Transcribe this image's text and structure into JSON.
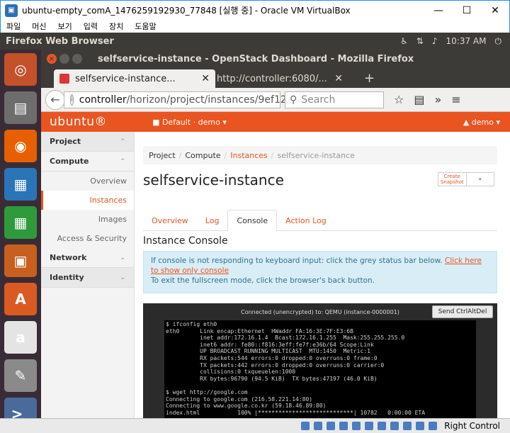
{
  "window": {
    "title": "ubuntu-empty_comA_1476259192930_77848 [실행 중] - Oracle VM VirtualBox",
    "min": "—",
    "max": "☐",
    "close": "✕"
  },
  "vbox_menu": [
    "파일",
    "머신",
    "보기",
    "입력",
    "장치",
    "도움말"
  ],
  "ubuntu_panel": {
    "app_name": "Firefox Web Browser",
    "time": "10:37 AM"
  },
  "launcher": [
    {
      "name": "ubuntu-dash-icon",
      "color": "#c3512a",
      "glyph": "◎"
    },
    {
      "name": "files-icon",
      "color": "#6d6d6d",
      "glyph": "▤"
    },
    {
      "name": "firefox-icon",
      "color": "#e66000",
      "glyph": "◉"
    },
    {
      "name": "writer-icon",
      "color": "#2a74b8",
      "glyph": "▦"
    },
    {
      "name": "calc-icon",
      "color": "#2f9a3b",
      "glyph": "▦"
    },
    {
      "name": "impress-icon",
      "color": "#c75f1f",
      "glyph": "▣"
    },
    {
      "name": "software-center-icon",
      "color": "#d95b22",
      "glyph": "A"
    },
    {
      "name": "amazon-icon",
      "color": "#e4e4e4",
      "glyph": "a"
    },
    {
      "name": "settings-icon",
      "color": "#8a8a8a",
      "glyph": "✎"
    },
    {
      "name": "terminal-icon",
      "color": "#4a6a9c",
      "glyph": ">_"
    }
  ],
  "firefox": {
    "window_title": "selfservice-instance - OpenStack Dashboard - Mozilla Firefox",
    "tabs": [
      {
        "label": "selfservice-instance..."
      },
      {
        "label": "http://controller:6080/..."
      }
    ],
    "new_tab": "+",
    "url_host": "controller",
    "url_path": "/horizon/project/instances/9ef12",
    "search_placeholder": "Search"
  },
  "horizon": {
    "logo": "ubuntu®",
    "project_selector": "■ Default · demo ▾",
    "user_menu": "▲ demo ▾",
    "sidebar": {
      "project": "Project",
      "compute": "Compute",
      "items": [
        "Overview",
        "Instances",
        "Images",
        "Access & Security"
      ],
      "network": "Network",
      "identity": "Identity"
    },
    "breadcrumb": {
      "project": "Project",
      "compute": "Compute",
      "instances": "Instances",
      "current": "selfservice-instance"
    },
    "page_title": "selfservice-instance",
    "create_snapshot": "Create Snapshot",
    "tabs": [
      "Overview",
      "Log",
      "Console",
      "Action Log"
    ],
    "section_title": "Instance Console",
    "alert": {
      "line1": "If console is not responding to keyboard input: click the grey status bar below.",
      "link": "Click here to show only console",
      "line2": "To exit the fullscreen mode, click the browser's back button."
    },
    "console_status": "Connected (unencrypted) to: QEMU (instance-0000001)",
    "send_ctrl_alt_del": "Send CtrlAltDel",
    "terminal": "$ ifconfig eth0\neth0      Link encap:Ethernet  HWaddr FA:16:3E:7F:E3:6B\n          inet addr:172.16.1.4  Bcast:172.16.1.255  Mask:255.255.255.0\n          inet6 addr: fe80::f816:3eff:fe7f:e36b/64 Scope:Link\n          UP BROADCAST RUNNING MULTICAST  MTU:1450  Metric:1\n          RX packets:544 errors:0 dropped:0 overruns:0 frame:0\n          TX packets:442 errors:0 dropped:0 overruns:0 carrier:0\n          collisions:0 txqueuelen:1000\n          RX bytes:96790 (94.5 KiB)  TX bytes:47197 (46.0 KiB)\n\n$ wget http://google.com\nConnecting to google.com (216.58.221.14:80)\nConnecting to www.google.co.kr (59.18.46.89:80)\nindex.html           100% |****************************| 10782   0:00:00 ETA"
  },
  "statusbar": {
    "right_control": "Right Control"
  }
}
